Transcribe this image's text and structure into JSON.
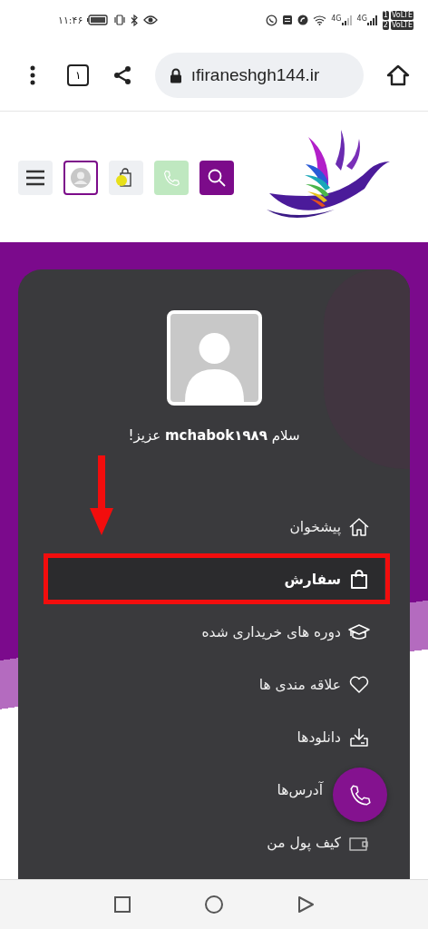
{
  "status_bar": {
    "time": "۱۱:۴۶",
    "network_labels": [
      "4G",
      "4G"
    ],
    "sims": [
      {
        "sim": "1",
        "volte": "VoLTE"
      },
      {
        "sim": "2",
        "volte": "VoLTE"
      }
    ]
  },
  "browser": {
    "tab_count": "۱",
    "url": "ıfiraneshgh144.ir"
  },
  "profile": {
    "greeting": "سلام **mchabok۱۹۸۹** عزیز!"
  },
  "menu": {
    "items": [
      {
        "label": "پیشخوان",
        "selected": false
      },
      {
        "label": "سفارش",
        "selected": true
      },
      {
        "label": "دوره های خریداری شده",
        "selected": false
      },
      {
        "label": "علاقه مندی ها",
        "selected": false
      },
      {
        "label": "دانلودها",
        "selected": false
      },
      {
        "label": "آدرس‌ها",
        "selected": false
      },
      {
        "label": "کیف پول من",
        "selected": false
      }
    ]
  }
}
